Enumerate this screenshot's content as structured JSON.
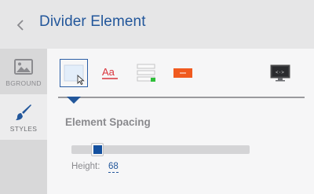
{
  "header": {
    "title": "Divider Element",
    "back_icon": "chevron-left-icon"
  },
  "rail": {
    "tabs": [
      {
        "label": "BGROUND",
        "icon": "image-icon",
        "active": false
      },
      {
        "label": "STYLES",
        "icon": "paintbrush-icon",
        "active": true
      }
    ]
  },
  "toolbar": {
    "tools": [
      {
        "name": "spacing",
        "icon": "spacing-box-icon",
        "selected": true
      },
      {
        "name": "text",
        "icon": "text-style-icon",
        "glyph": "Aa"
      },
      {
        "name": "lines",
        "icon": "lines-icon"
      },
      {
        "name": "button",
        "icon": "button-style-icon"
      },
      {
        "name": "html",
        "icon": "code-monitor-icon",
        "glyph": "<·>"
      }
    ]
  },
  "spacing": {
    "title": "Element Spacing",
    "height_label": "Height:",
    "height_value": "68",
    "slider_fraction": 0.12
  },
  "colors": {
    "accent": "#23579b",
    "slider_thumb": "#14509f",
    "text_icon_red": "#d9343c",
    "button_orange": "#f05a1f",
    "status_green": "#2fbf3a"
  }
}
